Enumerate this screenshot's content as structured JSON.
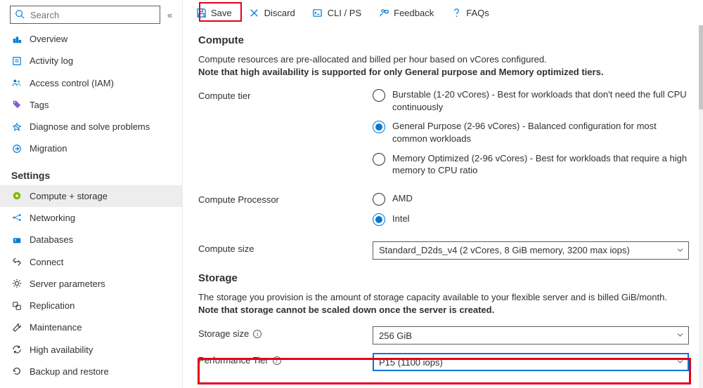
{
  "search": {
    "placeholder": "Search"
  },
  "nav": {
    "top": [
      {
        "label": "Overview"
      },
      {
        "label": "Activity log"
      },
      {
        "label": "Access control (IAM)"
      },
      {
        "label": "Tags"
      },
      {
        "label": "Diagnose and solve problems"
      },
      {
        "label": "Migration"
      }
    ],
    "settings_title": "Settings",
    "settings": [
      {
        "label": "Compute + storage"
      },
      {
        "label": "Networking"
      },
      {
        "label": "Databases"
      },
      {
        "label": "Connect"
      },
      {
        "label": "Server parameters"
      },
      {
        "label": "Replication"
      },
      {
        "label": "Maintenance"
      },
      {
        "label": "High availability"
      },
      {
        "label": "Backup and restore"
      }
    ]
  },
  "toolbar": {
    "save": "Save",
    "discard": "Discard",
    "cli": "CLI / PS",
    "feedback": "Feedback",
    "faqs": "FAQs"
  },
  "compute": {
    "heading": "Compute",
    "desc1": "Compute resources are pre-allocated and billed per hour based on vCores configured.",
    "desc2": "Note that high availability is supported for only General purpose and Memory optimized tiers.",
    "tier_label": "Compute tier",
    "tiers": [
      {
        "label": "Burstable (1-20 vCores) - Best for workloads that don't need the full CPU continuously"
      },
      {
        "label": "General Purpose (2-96 vCores) - Balanced configuration for most common workloads"
      },
      {
        "label": "Memory Optimized (2-96 vCores) - Best for workloads that require a high memory to CPU ratio"
      }
    ],
    "processor_label": "Compute Processor",
    "processors": [
      {
        "label": "AMD"
      },
      {
        "label": "Intel"
      }
    ],
    "size_label": "Compute size",
    "size_value": "Standard_D2ds_v4 (2 vCores, 8 GiB memory, 3200 max iops)"
  },
  "storage": {
    "heading": "Storage",
    "desc1": "The storage you provision is the amount of storage capacity available to your flexible server and is billed GiB/month.",
    "desc2": "Note that storage cannot be scaled down once the server is created.",
    "size_label": "Storage size",
    "size_value": "256 GiB",
    "perf_label": "Performance Tier",
    "perf_value": "P15 (1100 iops)"
  }
}
